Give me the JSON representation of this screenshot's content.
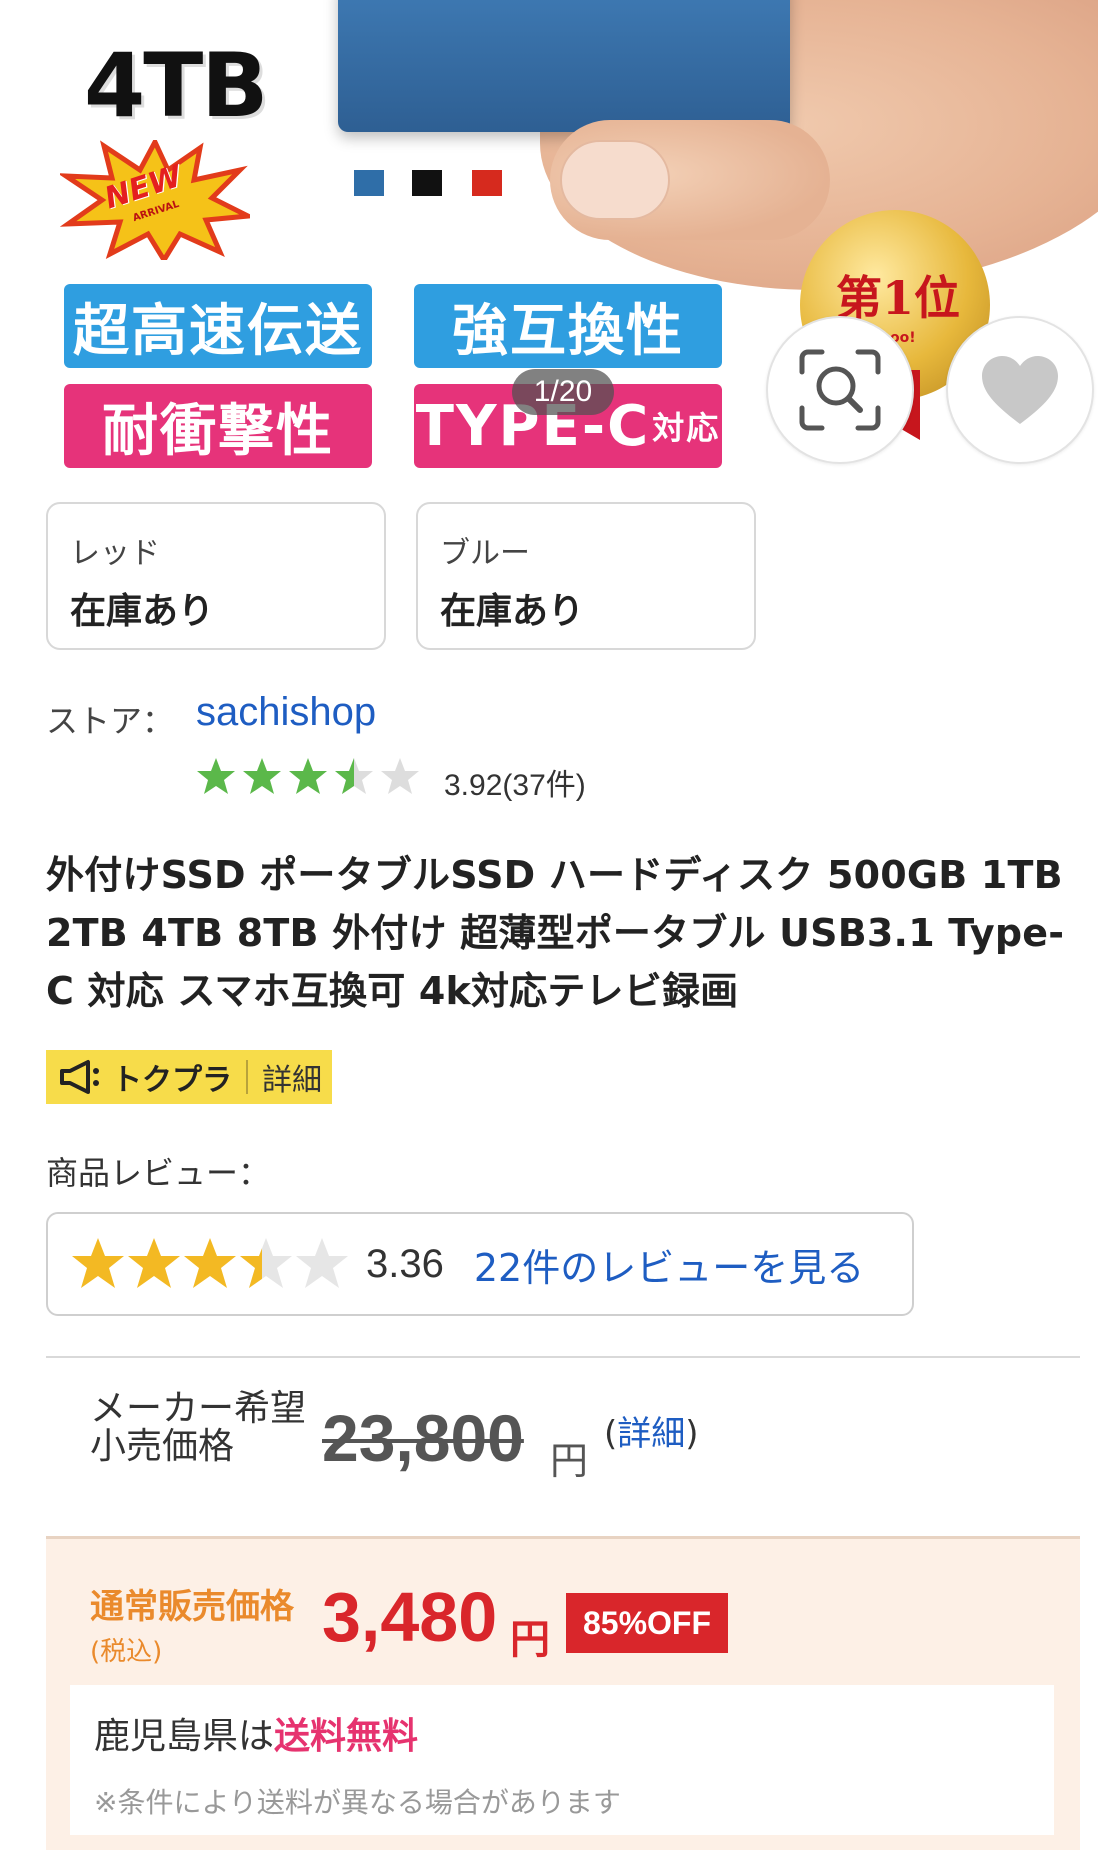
{
  "hero": {
    "capacity_text": "4TB",
    "new_badge": "NEW",
    "new_badge_sub": "ARRIVAL",
    "features": [
      "超高速伝送",
      "強互換性",
      "耐衝撃性"
    ],
    "type_c_main": "TYPE-C",
    "type_c_suffix": "対応",
    "medal_text": "第1位",
    "medal_sub": "hoo!",
    "image_counter": "1/20",
    "colors": {
      "blue": "#2f6ea8",
      "black": "#111111",
      "red": "#d62a1e"
    }
  },
  "variants": [
    {
      "name": "レッド",
      "stock": "在庫あり"
    },
    {
      "name": "ブルー",
      "stock": "在庫あり"
    }
  ],
  "store": {
    "label": "ストア：",
    "name": "sachishop",
    "rating": 3.92,
    "rating_text": "3.92(37件)",
    "star_color": "#5bb84a"
  },
  "product": {
    "title": "外付けSSD ポータブルSSD ハードディスク 500GB 1TB 2TB 4TB 8TB 外付け 超薄型ポータブル USB3.1 Type-C 対応 スマホ互換可 4k対応テレビ録画"
  },
  "promo": {
    "name": "トクプラ",
    "detail": "詳細",
    "icon": "megaphone-icon"
  },
  "review": {
    "label": "商品レビュー：",
    "score": 3.36,
    "score_text": "3.36",
    "link": "22件のレビューを見る",
    "star_color": "#f3b923"
  },
  "list_price": {
    "label_line1": "メーカー希望",
    "label_line2": "小売価格",
    "value": "23,800",
    "yen": "円",
    "detail_open": "(",
    "detail_link": "詳細",
    "detail_close": ")"
  },
  "sale": {
    "label": "通常販売価格",
    "tax": "(税込)",
    "price": "3,480",
    "yen": "円",
    "off": "85%OFF"
  },
  "shipping": {
    "prefix": "鹿児島県は",
    "free": "送料無料",
    "note": "※条件により送料が異なる場合があります"
  },
  "colors": {
    "accent_blue": "#1e5dc2",
    "sale_red": "#d9262b",
    "promo_yellow": "#f7dc4a"
  }
}
